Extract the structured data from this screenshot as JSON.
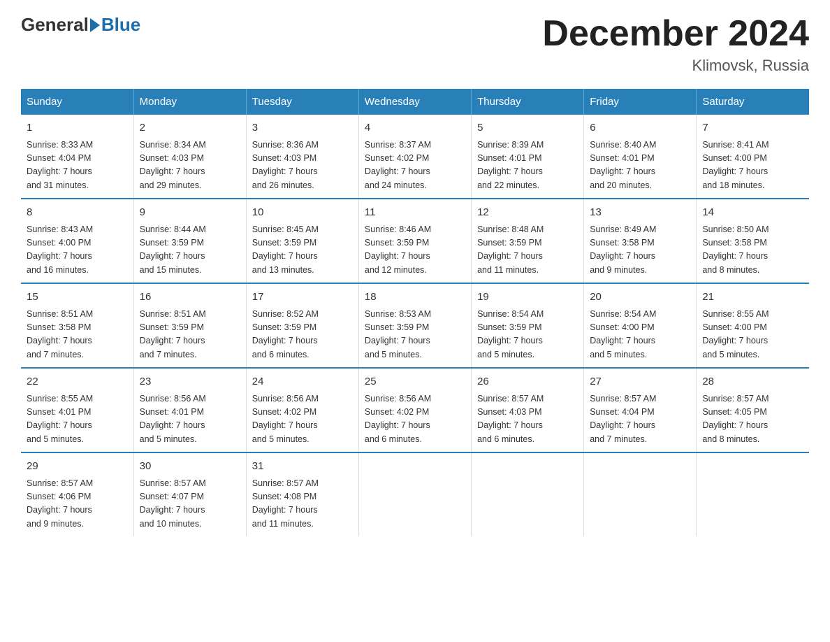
{
  "logo": {
    "general": "General",
    "blue": "Blue"
  },
  "title": "December 2024",
  "subtitle": "Klimovsk, Russia",
  "days_header": [
    "Sunday",
    "Monday",
    "Tuesday",
    "Wednesday",
    "Thursday",
    "Friday",
    "Saturday"
  ],
  "weeks": [
    [
      {
        "num": "1",
        "info": "Sunrise: 8:33 AM\nSunset: 4:04 PM\nDaylight: 7 hours\nand 31 minutes."
      },
      {
        "num": "2",
        "info": "Sunrise: 8:34 AM\nSunset: 4:03 PM\nDaylight: 7 hours\nand 29 minutes."
      },
      {
        "num": "3",
        "info": "Sunrise: 8:36 AM\nSunset: 4:03 PM\nDaylight: 7 hours\nand 26 minutes."
      },
      {
        "num": "4",
        "info": "Sunrise: 8:37 AM\nSunset: 4:02 PM\nDaylight: 7 hours\nand 24 minutes."
      },
      {
        "num": "5",
        "info": "Sunrise: 8:39 AM\nSunset: 4:01 PM\nDaylight: 7 hours\nand 22 minutes."
      },
      {
        "num": "6",
        "info": "Sunrise: 8:40 AM\nSunset: 4:01 PM\nDaylight: 7 hours\nand 20 minutes."
      },
      {
        "num": "7",
        "info": "Sunrise: 8:41 AM\nSunset: 4:00 PM\nDaylight: 7 hours\nand 18 minutes."
      }
    ],
    [
      {
        "num": "8",
        "info": "Sunrise: 8:43 AM\nSunset: 4:00 PM\nDaylight: 7 hours\nand 16 minutes."
      },
      {
        "num": "9",
        "info": "Sunrise: 8:44 AM\nSunset: 3:59 PM\nDaylight: 7 hours\nand 15 minutes."
      },
      {
        "num": "10",
        "info": "Sunrise: 8:45 AM\nSunset: 3:59 PM\nDaylight: 7 hours\nand 13 minutes."
      },
      {
        "num": "11",
        "info": "Sunrise: 8:46 AM\nSunset: 3:59 PM\nDaylight: 7 hours\nand 12 minutes."
      },
      {
        "num": "12",
        "info": "Sunrise: 8:48 AM\nSunset: 3:59 PM\nDaylight: 7 hours\nand 11 minutes."
      },
      {
        "num": "13",
        "info": "Sunrise: 8:49 AM\nSunset: 3:58 PM\nDaylight: 7 hours\nand 9 minutes."
      },
      {
        "num": "14",
        "info": "Sunrise: 8:50 AM\nSunset: 3:58 PM\nDaylight: 7 hours\nand 8 minutes."
      }
    ],
    [
      {
        "num": "15",
        "info": "Sunrise: 8:51 AM\nSunset: 3:58 PM\nDaylight: 7 hours\nand 7 minutes."
      },
      {
        "num": "16",
        "info": "Sunrise: 8:51 AM\nSunset: 3:59 PM\nDaylight: 7 hours\nand 7 minutes."
      },
      {
        "num": "17",
        "info": "Sunrise: 8:52 AM\nSunset: 3:59 PM\nDaylight: 7 hours\nand 6 minutes."
      },
      {
        "num": "18",
        "info": "Sunrise: 8:53 AM\nSunset: 3:59 PM\nDaylight: 7 hours\nand 5 minutes."
      },
      {
        "num": "19",
        "info": "Sunrise: 8:54 AM\nSunset: 3:59 PM\nDaylight: 7 hours\nand 5 minutes."
      },
      {
        "num": "20",
        "info": "Sunrise: 8:54 AM\nSunset: 4:00 PM\nDaylight: 7 hours\nand 5 minutes."
      },
      {
        "num": "21",
        "info": "Sunrise: 8:55 AM\nSunset: 4:00 PM\nDaylight: 7 hours\nand 5 minutes."
      }
    ],
    [
      {
        "num": "22",
        "info": "Sunrise: 8:55 AM\nSunset: 4:01 PM\nDaylight: 7 hours\nand 5 minutes."
      },
      {
        "num": "23",
        "info": "Sunrise: 8:56 AM\nSunset: 4:01 PM\nDaylight: 7 hours\nand 5 minutes."
      },
      {
        "num": "24",
        "info": "Sunrise: 8:56 AM\nSunset: 4:02 PM\nDaylight: 7 hours\nand 5 minutes."
      },
      {
        "num": "25",
        "info": "Sunrise: 8:56 AM\nSunset: 4:02 PM\nDaylight: 7 hours\nand 6 minutes."
      },
      {
        "num": "26",
        "info": "Sunrise: 8:57 AM\nSunset: 4:03 PM\nDaylight: 7 hours\nand 6 minutes."
      },
      {
        "num": "27",
        "info": "Sunrise: 8:57 AM\nSunset: 4:04 PM\nDaylight: 7 hours\nand 7 minutes."
      },
      {
        "num": "28",
        "info": "Sunrise: 8:57 AM\nSunset: 4:05 PM\nDaylight: 7 hours\nand 8 minutes."
      }
    ],
    [
      {
        "num": "29",
        "info": "Sunrise: 8:57 AM\nSunset: 4:06 PM\nDaylight: 7 hours\nand 9 minutes."
      },
      {
        "num": "30",
        "info": "Sunrise: 8:57 AM\nSunset: 4:07 PM\nDaylight: 7 hours\nand 10 minutes."
      },
      {
        "num": "31",
        "info": "Sunrise: 8:57 AM\nSunset: 4:08 PM\nDaylight: 7 hours\nand 11 minutes."
      },
      {
        "num": "",
        "info": ""
      },
      {
        "num": "",
        "info": ""
      },
      {
        "num": "",
        "info": ""
      },
      {
        "num": "",
        "info": ""
      }
    ]
  ]
}
